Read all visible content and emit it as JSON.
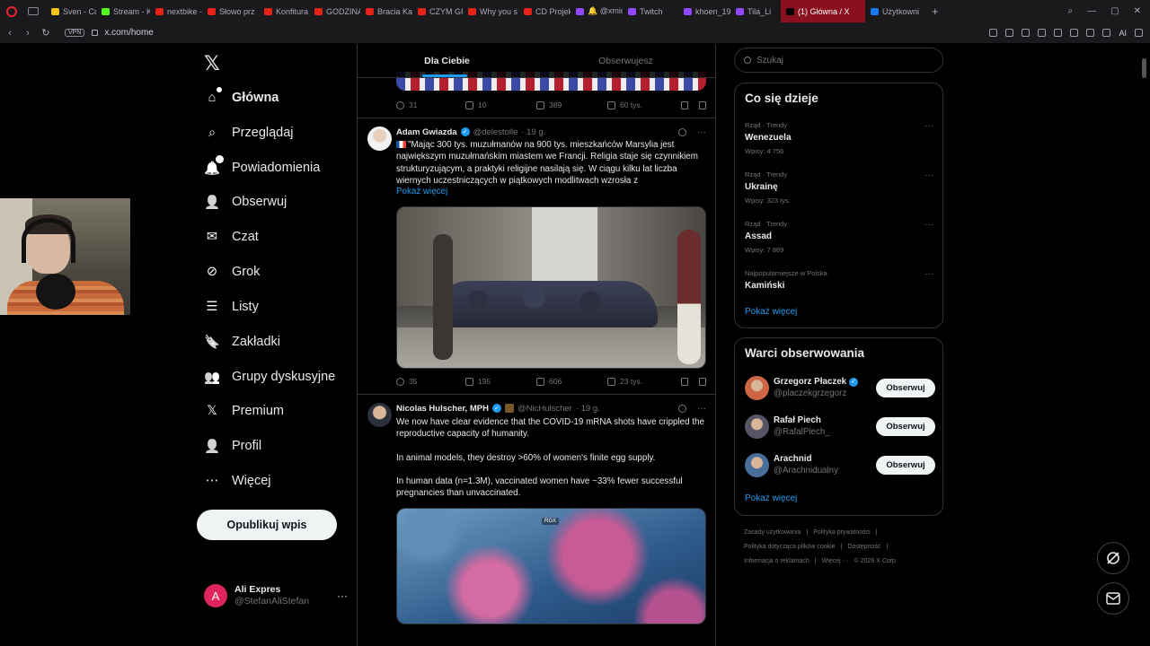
{
  "browser": {
    "tabs": [
      {
        "label": "Sven - Co",
        "color": "#f5c518"
      },
      {
        "label": "Stream - K",
        "color": "#53fc18"
      },
      {
        "label": "nextbike -",
        "color": "#e62117"
      },
      {
        "label": "Słowo prz",
        "color": "#e62117"
      },
      {
        "label": "Konfitura",
        "color": "#e62117"
      },
      {
        "label": "GODZINA",
        "color": "#e62117"
      },
      {
        "label": "Bracia Kar",
        "color": "#e62117"
      },
      {
        "label": "CZYM GR",
        "color": "#e62117"
      },
      {
        "label": "Why you s",
        "color": "#e62117"
      },
      {
        "label": "CD Projekt",
        "color": "#e62117"
      },
      {
        "label": "🔔 @xmic",
        "color": "#9146ff"
      },
      {
        "label": "Twitch",
        "color": "#9146ff"
      },
      {
        "label": "khoen_19",
        "color": "#9146ff"
      },
      {
        "label": "Tila_Li",
        "color": "#9146ff"
      },
      {
        "label": "(1) Główna / X",
        "color": "#000000",
        "active": true
      },
      {
        "label": "Użytkowni",
        "color": "#1877f2"
      }
    ],
    "url": "x.com/home",
    "vpn": "VPN",
    "ai_label": "AI"
  },
  "nav": {
    "items": [
      {
        "label": "Główna",
        "icon": "home-icon"
      },
      {
        "label": "Przeglądaj",
        "icon": "search-icon"
      },
      {
        "label": "Powiadomienia",
        "icon": "bell-icon",
        "badge": "1"
      },
      {
        "label": "Obserwuj",
        "icon": "follow-icon"
      },
      {
        "label": "Czat",
        "icon": "mail-icon"
      },
      {
        "label": "Grok",
        "icon": "grok-icon"
      },
      {
        "label": "Listy",
        "icon": "list-icon"
      },
      {
        "label": "Zakładki",
        "icon": "bookmark-icon"
      },
      {
        "label": "Grupy dyskusyjne",
        "icon": "communities-icon"
      },
      {
        "label": "Premium",
        "icon": "x-icon"
      },
      {
        "label": "Profil",
        "icon": "profile-icon"
      },
      {
        "label": "Więcej",
        "icon": "more-icon"
      }
    ],
    "post_button": "Opublikuj wpis",
    "account": {
      "initial": "A",
      "name": "Ali Expres",
      "handle": "@StefanAliStefan"
    }
  },
  "feed": {
    "tabs": [
      "Dla Ciebie",
      "Obserwujesz"
    ],
    "prev_tweet_stats": {
      "replies": "31",
      "reposts": "10",
      "likes": "389",
      "views": "60 tys."
    },
    "tweets": [
      {
        "name": "Adam Gwiazda",
        "handle": "@delestolle",
        "time": "· 19 g.",
        "text": "\"Mając 300 tys. muzułmanów na 900 tys. mieszkańców Marsylia jest największym muzułmańskim miastem we Francji. Religia staje się czynnikiem strukturyzującym, a praktyki religijne nasilają się. W ciągu kilku lat liczba wiernych uczestniczących w piątkowych modlitwach wzrosła z",
        "show_more": "Pokaż więcej",
        "stats": {
          "replies": "35",
          "reposts": "195",
          "likes": "606",
          "views": "23 tys."
        }
      },
      {
        "name": "Nicolas Hulscher, MPH",
        "handle": "@NicHulscher",
        "time": "· 19 g.",
        "paragraphs": [
          "We now have clear evidence that the COVID-19 mRNA shots have crippled the reproductive capacity of humanity.",
          "In animal models, they destroy >60% of women's finite egg supply.",
          "In human data (n=1.3M), vaccinated women have ~33% fewer successful pregnancies than unvaccinated."
        ],
        "image_tag": "RGX"
      }
    ]
  },
  "sidebar": {
    "search_placeholder": "Szukaj",
    "trends_title": "Co się dzieje",
    "trends": [
      {
        "meta": "Rząd · Trendy",
        "topic": "Wenezuela",
        "count": "Wpisy: 4 756"
      },
      {
        "meta": "Rząd · Trendy",
        "topic": "Ukrainę",
        "count": "Wpisy: 323 tys."
      },
      {
        "meta": "Rząd · Trendy",
        "topic": "Assad",
        "count": "Wpisy: 7 869"
      },
      {
        "meta": "Najpopularniejsze w Polska",
        "topic": "Kamiński",
        "count": ""
      }
    ],
    "show_more": "Pokaż więcej",
    "who_title": "Warci obserwowania",
    "who": [
      {
        "name": "Grzegorz Płaczek",
        "handle": "@placzekgrzegorz",
        "verified": true,
        "color": "#c64"
      },
      {
        "name": "Rafał Piech",
        "handle": "@RafalPiech_",
        "verified": false,
        "color": "#556"
      },
      {
        "name": "Arachnid",
        "handle": "@Arachnidualny",
        "verified": false,
        "color": "#4a6e9a"
      }
    ],
    "follow_label": "Obserwuj",
    "footer": [
      "Zasady użytkowania",
      "|",
      "Polityka prywatności",
      "|",
      "Polityka dotycząca plików cookie",
      "|",
      "Dostępność",
      "|",
      "Informacja o reklamach",
      "|",
      "Więcej ···",
      "© 2026 X Corp."
    ]
  }
}
